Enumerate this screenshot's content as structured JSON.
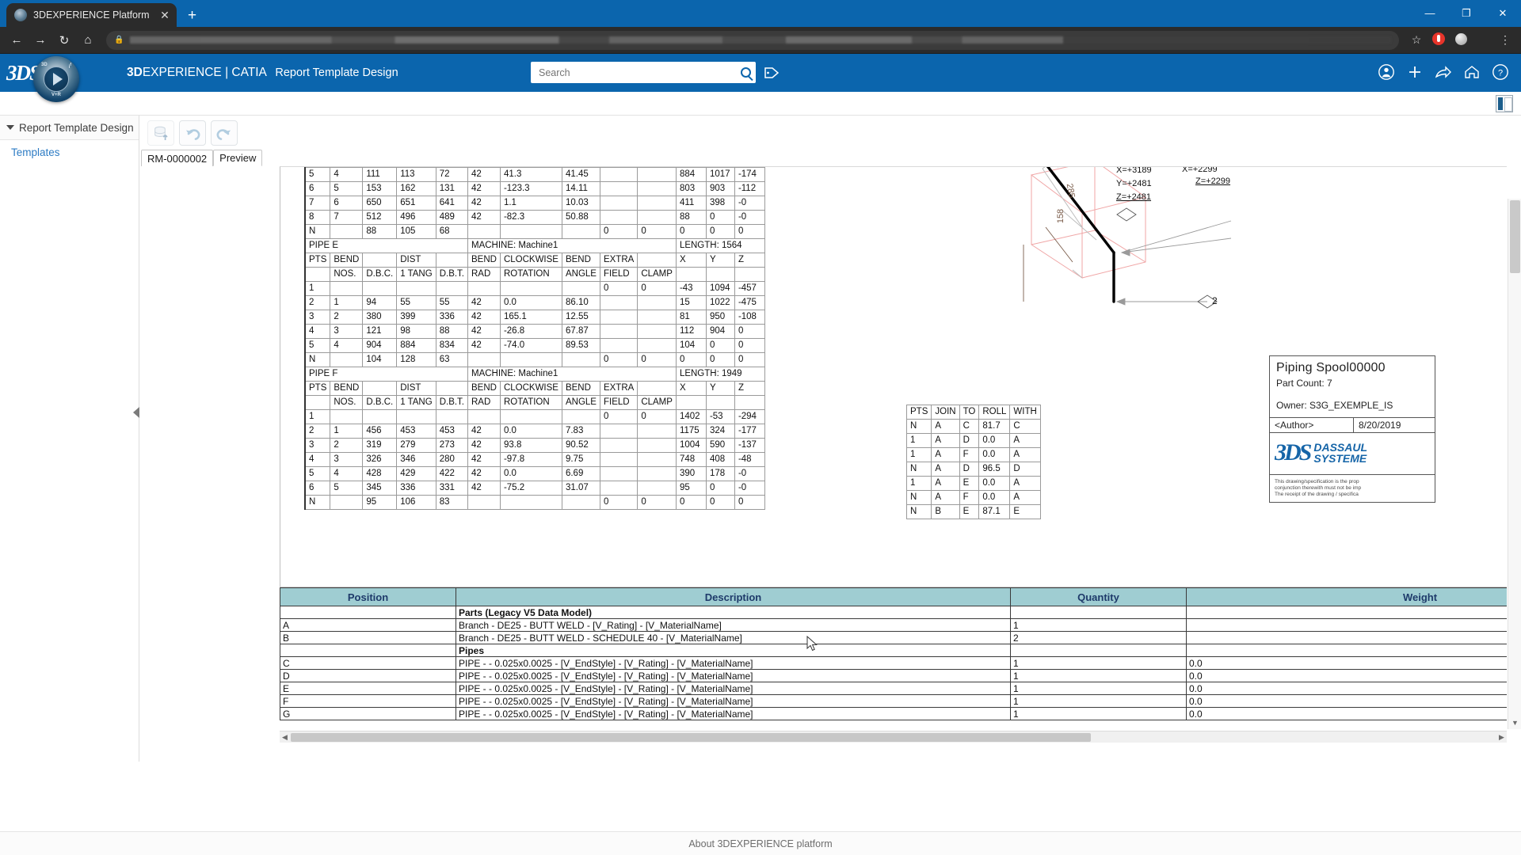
{
  "browser": {
    "tab_title": "3DEXPERIENCE Platform",
    "tab_close": "✕",
    "new_tab": "+",
    "back": "←",
    "forward": "→",
    "reload": "↻",
    "home": "⌂",
    "lock": "ὑ2",
    "bookmark": "☆",
    "menu": "⋮",
    "minimize": "—",
    "maximize": "❐",
    "close": "✕"
  },
  "appbar": {
    "logo": "3DS",
    "brand_bold": "3D",
    "brand_rest": "EXPERIENCE",
    "separator": "|",
    "product": "CATIA",
    "app_name": "Report Template Design",
    "search_placeholder": "Search",
    "search_value": "",
    "icons": {
      "tag": "tag-icon",
      "account": "account-icon",
      "add": "+",
      "share": "share-icon",
      "home": "home-icon",
      "help": "?"
    },
    "accent_color": "#0b65ad"
  },
  "sidebar": {
    "title": "Report Template Design",
    "items": [
      {
        "label": "Templates"
      }
    ]
  },
  "toolbar": {
    "save_label": "save-to-database",
    "undo_label": "undo",
    "redo_label": "redo"
  },
  "doc_tabs": [
    {
      "label": "RM-0000002",
      "selected": false
    },
    {
      "label": "Preview",
      "selected": true
    }
  ],
  "drawing": {
    "bend_table": {
      "columns": [
        "PTS",
        "NOS.",
        "D.B.C.",
        "1 TANG",
        "D.B.T.",
        "RAD",
        "ROTATION",
        "ANGLE",
        "FIELD",
        "CLAMP",
        "X",
        "Y",
        "Z"
      ],
      "group_headers": [
        "PTS",
        "BEND",
        "",
        "DIST",
        "",
        "BEND",
        "CLOCKWISE",
        "BEND",
        "EXTRA",
        "",
        "X",
        "Y",
        "Z"
      ],
      "sections": [
        {
          "pipe": "",
          "machine": "",
          "length": "",
          "show_header": false,
          "rows": [
            [
              "5",
              "4",
              "111",
              "113",
              "72",
              "42",
              "41.3",
              "41.45",
              "",
              "",
              "884",
              "1017",
              "-174"
            ],
            [
              "6",
              "5",
              "153",
              "162",
              "131",
              "42",
              "-123.3",
              "14.11",
              "",
              "",
              "803",
              "903",
              "-112"
            ],
            [
              "7",
              "6",
              "650",
              "651",
              "641",
              "42",
              "1.1",
              "10.03",
              "",
              "",
              "411",
              "398",
              "-0"
            ],
            [
              "8",
              "7",
              "512",
              "496",
              "489",
              "42",
              "-82.3",
              "50.88",
              "",
              "",
              "88",
              "0",
              "-0"
            ],
            [
              "N",
              "",
              "88",
              "105",
              "68",
              "",
              "",
              "",
              "0",
              "0",
              "0",
              "0",
              "0"
            ]
          ]
        },
        {
          "pipe": "PIPE  E",
          "machine": "MACHINE: Machine1",
          "length": "LENGTH:  1564",
          "show_header": true,
          "rows": [
            [
              "1",
              "",
              "",
              "",
              "",
              "",
              "",
              "",
              "0",
              "0",
              "-43",
              "1094",
              "-457"
            ],
            [
              "2",
              "1",
              "94",
              "55",
              "55",
              "42",
              "0.0",
              "86.10",
              "",
              "",
              "15",
              "1022",
              "-475"
            ],
            [
              "3",
              "2",
              "380",
              "399",
              "336",
              "42",
              "165.1",
              "12.55",
              "",
              "",
              "81",
              "950",
              "-108"
            ],
            [
              "4",
              "3",
              "121",
              "98",
              "88",
              "42",
              "-26.8",
              "67.87",
              "",
              "",
              "112",
              "904",
              "0"
            ],
            [
              "5",
              "4",
              "904",
              "884",
              "834",
              "42",
              "-74.0",
              "89.53",
              "",
              "",
              "104",
              "0",
              "0"
            ],
            [
              "N",
              "",
              "104",
              "128",
              "63",
              "",
              "",
              "",
              "0",
              "0",
              "0",
              "0",
              "0"
            ]
          ]
        },
        {
          "pipe": "PIPE  F",
          "machine": "MACHINE: Machine1",
          "length": "LENGTH:  1949",
          "show_header": true,
          "rows": [
            [
              "1",
              "",
              "",
              "",
              "",
              "",
              "",
              "",
              "0",
              "0",
              "1402",
              "-53",
              "-294"
            ],
            [
              "2",
              "1",
              "456",
              "453",
              "453",
              "42",
              "0.0",
              "7.83",
              "",
              "",
              "1175",
              "324",
              "-177"
            ],
            [
              "3",
              "2",
              "319",
              "279",
              "273",
              "42",
              "93.8",
              "90.52",
              "",
              "",
              "1004",
              "590",
              "-137"
            ],
            [
              "4",
              "3",
              "326",
              "346",
              "280",
              "42",
              "-97.8",
              "9.75",
              "",
              "",
              "748",
              "408",
              "-48"
            ],
            [
              "5",
              "4",
              "428",
              "429",
              "422",
              "42",
              "0.0",
              "6.69",
              "",
              "",
              "390",
              "178",
              "-0"
            ],
            [
              "6",
              "5",
              "345",
              "336",
              "331",
              "42",
              "-75.2",
              "31.07",
              "",
              "",
              "95",
              "0",
              "-0"
            ],
            [
              "N",
              "",
              "95",
              "106",
              "83",
              "",
              "",
              "",
              "0",
              "0",
              "0",
              "0",
              "0"
            ]
          ]
        }
      ]
    },
    "join_table": {
      "columns": [
        "PTS",
        "JOIN",
        "TO",
        "ROLL",
        "WITH"
      ],
      "rows": [
        [
          "N",
          "A",
          "C",
          "81.7",
          "C"
        ],
        [
          "1",
          "A",
          "D",
          "0.0",
          "A"
        ],
        [
          "1",
          "A",
          "F",
          "0.0",
          "A"
        ],
        [
          "N",
          "A",
          "D",
          "96.5",
          "D"
        ],
        [
          "1",
          "A",
          "E",
          "0.0",
          "A"
        ],
        [
          "N",
          "A",
          "F",
          "0.0",
          "A"
        ],
        [
          "N",
          "B",
          "E",
          "87.1",
          "E"
        ]
      ]
    },
    "annotations": {
      "x": "X=+3189",
      "y": "Y=+2481",
      "z": "Z=+2481",
      "x2": "X=+2299",
      "z2": "Z=+2299",
      "balloon_2": "2",
      "dim_285": "285",
      "dim_158": "158"
    },
    "title_block": {
      "name": "Piping Spool00000",
      "part_count": "Part Count: 7",
      "owner": "Owner: S3G_EXEMPLE_IS",
      "author": "<Author>",
      "date": "8/20/2019",
      "company_mark": "3DS",
      "company_line1": "DASSAUL",
      "company_line2": "SYSTEME",
      "legal": [
        "This drawing/specification is the prop",
        "conjunction therewith must not be imp",
        "The receipt of the drawing / specifica"
      ]
    }
  },
  "bom": {
    "columns": [
      "Position",
      "Description",
      "Quantity",
      "Weight"
    ],
    "rows": [
      {
        "position": "",
        "description": "Parts (Legacy V5 Data Model)",
        "quantity": "",
        "weight": "",
        "bold": true
      },
      {
        "position": "A",
        "description": "Branch - DE25 - BUTT WELD - [V_Rating] - [V_MaterialName]",
        "quantity": "1",
        "weight": "",
        "bold": false
      },
      {
        "position": "B",
        "description": "Branch - DE25 - BUTT WELD - SCHEDULE 40 - [V_MaterialName]",
        "quantity": "2",
        "weight": "",
        "bold": false
      },
      {
        "position": "",
        "description": "Pipes",
        "quantity": "",
        "weight": "",
        "bold": true
      },
      {
        "position": "C",
        "description": "PIPE - - 0.025x0.0025 - [V_EndStyle] - [V_Rating] - [V_MaterialName]",
        "quantity": "1",
        "weight": "0.0",
        "bold": false
      },
      {
        "position": "D",
        "description": "PIPE - - 0.025x0.0025 - [V_EndStyle] - [V_Rating] - [V_MaterialName]",
        "quantity": "1",
        "weight": "0.0",
        "bold": false
      },
      {
        "position": "E",
        "description": "PIPE - - 0.025x0.0025 - [V_EndStyle] - [V_Rating] - [V_MaterialName]",
        "quantity": "1",
        "weight": "0.0",
        "bold": false
      },
      {
        "position": "F",
        "description": "PIPE - - 0.025x0.0025 - [V_EndStyle] - [V_Rating] - [V_MaterialName]",
        "quantity": "1",
        "weight": "0.0",
        "bold": false
      },
      {
        "position": "G",
        "description": "PIPE - - 0.025x0.0025 - [V_EndStyle] - [V_Rating] - [V_MaterialName]",
        "quantity": "1",
        "weight": "0.0",
        "bold": false
      }
    ]
  },
  "footer": {
    "about": "About 3DEXPERIENCE platform"
  }
}
